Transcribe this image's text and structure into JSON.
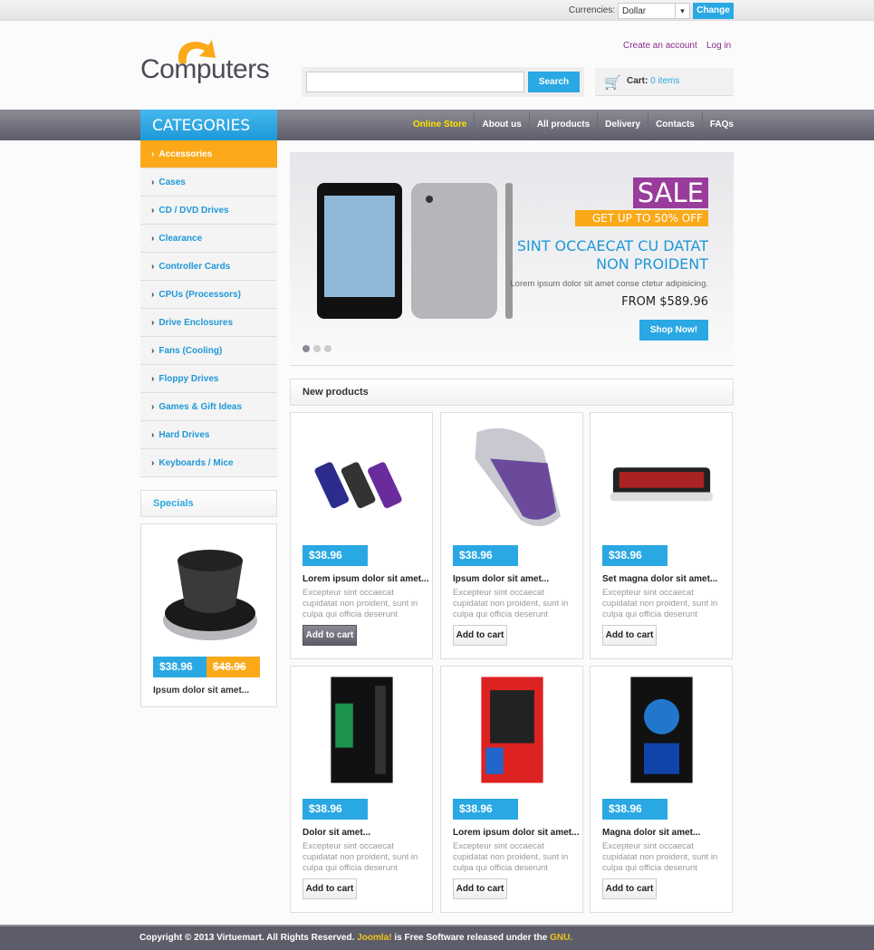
{
  "topbar": {
    "currencies_label": "Currencies:",
    "currency": "Dollar",
    "change": "Change"
  },
  "header": {
    "logo_text": "Computers",
    "create_account": "Create an account",
    "login": "Log in",
    "search_button": "Search",
    "search_placeholder": "",
    "cart_label": "Cart:",
    "cart_items": "0 items"
  },
  "nav": {
    "categories_title": "CATEGORIES",
    "items": [
      "Online Store",
      "About us",
      "All products",
      "Delivery",
      "Contacts",
      "FAQs"
    ],
    "active": "Online Store"
  },
  "categories": [
    "Accessories",
    "Cases",
    "CD / DVD Drives",
    "Clearance",
    "Controller Cards",
    "CPUs (Processors)",
    "Drive Enclosures",
    "Fans (Cooling)",
    "Floppy Drives",
    "Games & Gift Ideas",
    "Hard Drives",
    "Keyboards / Mice"
  ],
  "specials": {
    "title": "Specials",
    "price": "$38.96",
    "old_price": "$48.96",
    "name": "Ipsum dolor sit amet..."
  },
  "banner": {
    "sale": "SALE",
    "offer": "GET UP TO 50% OFF",
    "heading_line1": "SINT OCCAECAT CU DATAT",
    "heading_line2": "NON PROIDENT",
    "text": "Lorem ipsum dolor sit amet conse ctetur adipisicing.",
    "price": "FROM $589.96",
    "button": "Shop Now!",
    "slides": 3,
    "active_slide": 1
  },
  "new_products": {
    "title": "New products",
    "items": [
      {
        "name": "Lorem ipsum dolor sit amet...",
        "price": "$38.96",
        "desc": "Excepteur sint occaecat cupidatat non proident, sunt in culpa qui officia deserunt",
        "button": "Add to cart",
        "image": "usb-flash-drives"
      },
      {
        "name": "Ipsum dolor sit amet...",
        "price": "$38.96",
        "desc": "Excepteur sint occaecat cupidatat non proident, sunt in culpa qui officia deserunt",
        "button": "Add to cart",
        "image": "mouse"
      },
      {
        "name": "Set magna dolor sit amet...",
        "price": "$38.96",
        "desc": "Excepteur sint occaecat cupidatat non proident, sunt in culpa qui officia deserunt",
        "button": "Add to cart",
        "image": "keyboard"
      },
      {
        "name": "Dolor sit amet...",
        "price": "$38.96",
        "desc": "Excepteur sint occaecat cupidatat non proident, sunt in culpa qui officia deserunt",
        "button": "Add to cart",
        "image": "pc-case-green"
      },
      {
        "name": "Lorem ipsum dolor sit amet...",
        "price": "$38.96",
        "desc": "Excepteur sint occaecat cupidatat non proident, sunt in culpa qui officia deserunt",
        "button": "Add to cart",
        "image": "pc-case-red"
      },
      {
        "name": "Magna dolor sit amet...",
        "price": "$38.96",
        "desc": "Excepteur sint occaecat cupidatat non proident, sunt in culpa qui officia deserunt",
        "button": "Add to cart",
        "image": "pc-case-blue"
      }
    ]
  },
  "footer": {
    "text1": "Copyright © 2013 Virtuemart. All Rights Reserved. ",
    "joomla": "Joomla!",
    "text2": " is Free Software released under the ",
    "gnu": "GNU."
  },
  "colors": {
    "accent": "#2aa8e3",
    "orange": "#fba918",
    "purple": "#993c9b",
    "nav": "#5c5d69"
  }
}
